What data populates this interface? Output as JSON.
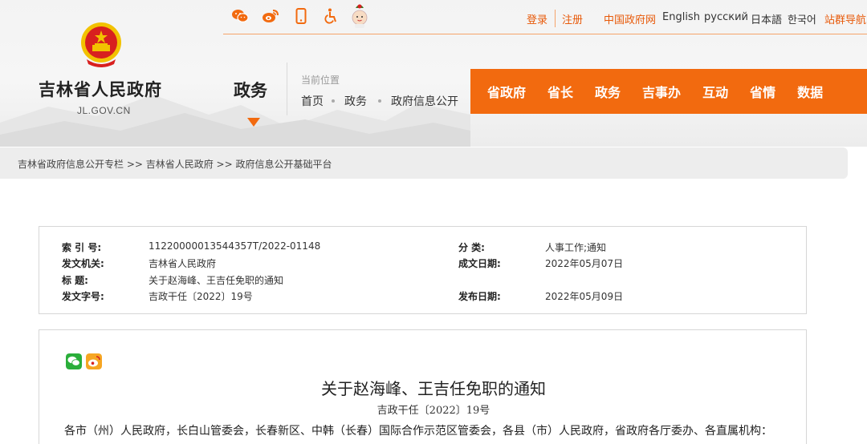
{
  "header": {
    "site_name": "吉林省人民政府",
    "site_domain": "JL.GOV.CN",
    "section_title": "政务",
    "location_label": "当前位置",
    "location_crumbs": [
      "首页",
      "政务",
      "政府信息公开"
    ]
  },
  "top_bar": {
    "social_icons": [
      "wechat-icon",
      "weibo-icon",
      "mobile-icon",
      "accessibility-icon",
      "mascot-icon"
    ],
    "login": "登录",
    "register": "注册",
    "gov_link": "中国政府网",
    "lang_english": "English",
    "lang_russian": "русский",
    "lang_japanese": "日本語",
    "lang_korean": "한국어",
    "site_group": "站群导航"
  },
  "main_nav": [
    "省政府",
    "省长",
    "政务",
    "吉事办",
    "互动",
    "省情",
    "数据"
  ],
  "breadcrumb": "吉林省政府信息公开专栏 >> 吉林省人民政府 >> 政府信息公开基础平台",
  "info": {
    "index_label": "索 引 号:",
    "index_value": "11220000013544357T/2022-01148",
    "category_label": "分 类:",
    "category_value": "人事工作;通知",
    "issuer_label": "发文机关:",
    "issuer_value": "吉林省人民政府",
    "date_created_label": "成文日期:",
    "date_created_value": "2022年05月07日",
    "title_label": "标 题:",
    "title_value": "关于赵海峰、王吉任免职的通知",
    "doc_no_label": "发文字号:",
    "doc_no_value": "吉政干任〔2022〕19号",
    "publish_date_label": "发布日期:",
    "publish_date_value": "2022年05月09日"
  },
  "article": {
    "share_icons": [
      "wechat-share-icon",
      "weibo-share-icon"
    ],
    "title": "关于赵海峰、王吉任免职的通知",
    "doc_number": "吉政干任〔2022〕19号",
    "body_first_line": "各市（州）人民政府，长白山管委会，长春新区、中韩（长春）国际合作示范区管委会，各县（市）人民政府，省政府各厅委办、各直属机构："
  },
  "colors": {
    "accent": "#f26a0f",
    "link_orange": "#e85a0a",
    "emblem_red": "#d8201f",
    "emblem_gold": "#f2c200"
  }
}
